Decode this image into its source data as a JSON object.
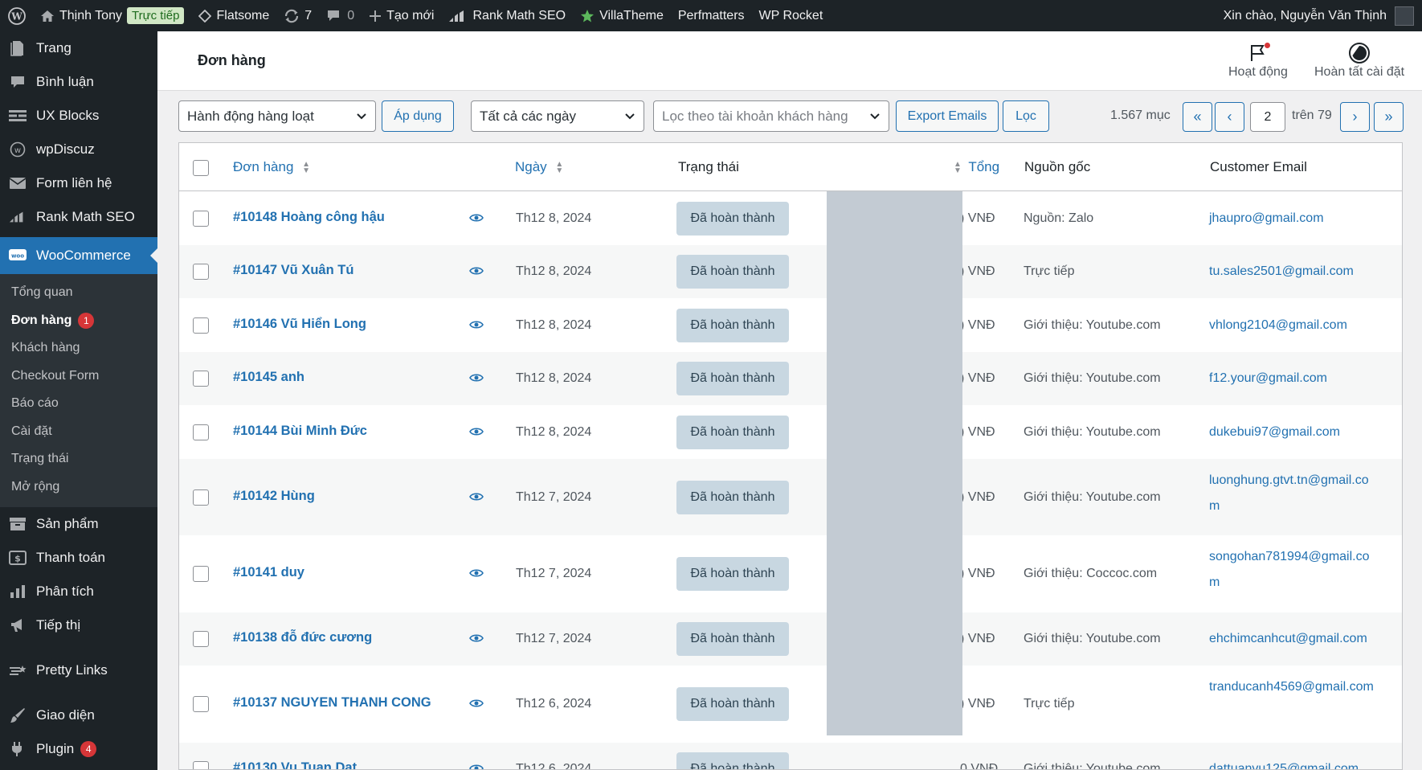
{
  "adminbar": {
    "site_name": "Thịnh Tony",
    "live_badge": "Trực tiếp",
    "theme": "Flatsome",
    "updates_count": "7",
    "comments_count": "0",
    "new_label": "Tạo mới",
    "rankmath": "Rank Math SEO",
    "villatheme": "VillaTheme",
    "perfmatters": "Perfmatters",
    "wprocket": "WP Rocket",
    "greeting": "Xin chào, Nguyễn Văn Thịnh"
  },
  "sidebar": {
    "items_top": [
      {
        "label": "Trang",
        "icon": "page-icon"
      },
      {
        "label": "Bình luận",
        "icon": "comment-icon"
      },
      {
        "label": "UX Blocks",
        "icon": "blocks-icon"
      },
      {
        "label": "wpDiscuz",
        "icon": "discuz-icon"
      },
      {
        "label": "Form liên hệ",
        "icon": "mail-icon"
      },
      {
        "label": "Rank Math SEO",
        "icon": "rankmath-icon"
      }
    ],
    "active": {
      "label": "WooCommerce",
      "icon": "woo-icon"
    },
    "submenu": [
      {
        "label": "Tổng quan"
      },
      {
        "label": "Đơn hàng",
        "badge": "1"
      },
      {
        "label": "Khách hàng"
      },
      {
        "label": "Checkout Form"
      },
      {
        "label": "Báo cáo"
      },
      {
        "label": "Cài đặt"
      },
      {
        "label": "Trạng thái"
      },
      {
        "label": "Mở rộng"
      }
    ],
    "items_bottom": [
      {
        "label": "Sản phẩm",
        "icon": "archive-icon"
      },
      {
        "label": "Thanh toán",
        "icon": "payment-icon"
      },
      {
        "label": "Phân tích",
        "icon": "chart-icon"
      },
      {
        "label": "Tiếp thị",
        "icon": "megaphone-icon"
      },
      {
        "label": "Pretty Links",
        "icon": "star-link-icon"
      },
      {
        "label": "Giao diện",
        "icon": "brush-icon"
      },
      {
        "label": "Plugin",
        "icon": "plugin-icon",
        "badge": "4"
      }
    ]
  },
  "header": {
    "title": "Đơn hàng",
    "activity": "Hoạt động",
    "finish_setup": "Hoàn tất cài đặt"
  },
  "toolbar": {
    "bulk_action": "Hành động hàng loạt",
    "apply": "Áp dụng",
    "date_filter": "Tất cả các ngày",
    "customer_filter": "Lọc theo tài khoản khách hàng",
    "export": "Export Emails",
    "filter": "Lọc",
    "items_count": "1.567 mục",
    "first": "«",
    "prev": "‹",
    "current_page": "2",
    "of_pages": "trên 79",
    "next": "›",
    "last": "»"
  },
  "table": {
    "headers": {
      "order": "Đơn hàng",
      "date": "Ngày",
      "status": "Trạng thái",
      "total": "Tổng",
      "source": "Nguồn gốc",
      "email": "Customer Email"
    },
    "rows": [
      {
        "order": "#10148 Hoàng công hậu",
        "date": "Th12 8, 2024",
        "status": "Đã hoàn thành",
        "total": ") VNĐ",
        "source": "Nguồn: Zalo",
        "email": "jhaupro@gmail.com"
      },
      {
        "order": "#10147 Vũ Xuân Tú",
        "date": "Th12 8, 2024",
        "status": "Đã hoàn thành",
        "total": ") VNĐ",
        "source": "Trực tiếp",
        "email": "tu.sales2501@gmail.com"
      },
      {
        "order": "#10146 Vũ Hiển Long",
        "date": "Th12 8, 2024",
        "status": "Đã hoàn thành",
        "total": ") VNĐ",
        "source": "Giới thiệu: Youtube.com",
        "email": "vhlong2104@gmail.com"
      },
      {
        "order": "#10145 anh",
        "date": "Th12 8, 2024",
        "status": "Đã hoàn thành",
        "total": ") VNĐ",
        "source": "Giới thiệu: Youtube.com",
        "email": "f12.your@gmail.com"
      },
      {
        "order": "#10144 Bùi Minh Đức",
        "date": "Th12 8, 2024",
        "status": "Đã hoàn thành",
        "total": ") VNĐ",
        "source": "Giới thiệu: Youtube.com",
        "email": "dukebui97@gmail.com"
      },
      {
        "order": "#10142 Hùng",
        "date": "Th12 7, 2024",
        "status": "Đã hoàn thành",
        "total": ") VNĐ",
        "source": "Giới thiệu: Youtube.com",
        "email": "luonghung.gtvt.tn@gmail.com"
      },
      {
        "order": "#10141 duy",
        "date": "Th12 7, 2024",
        "status": "Đã hoàn thành",
        "total": ") VNĐ",
        "source": "Giới thiệu: Coccoc.com",
        "email": "songohan781994@gmail.com"
      },
      {
        "order": "#10138 đỗ đức cương",
        "date": "Th12 7, 2024",
        "status": "Đã hoàn thành",
        "total": ") VNĐ",
        "source": "Giới thiệu: Youtube.com",
        "email": "ehchimcanhcut@gmail.com"
      },
      {
        "order": "#10137 NGUYEN THANH CONG",
        "date": "Th12 6, 2024",
        "status": "Đã hoàn thành",
        "total": ") VNĐ",
        "source": "Trực tiếp",
        "email": "tranducanh4569@gmail.com"
      },
      {
        "order": "#10130 Vu Tuan Dat",
        "date": "Th12 6, 2024",
        "status": "Đã hoàn thành",
        "total": "0 VNĐ",
        "source": "Giới thiệu: Youtube.com",
        "email": "dattuanvu125@gmail.com"
      }
    ]
  }
}
